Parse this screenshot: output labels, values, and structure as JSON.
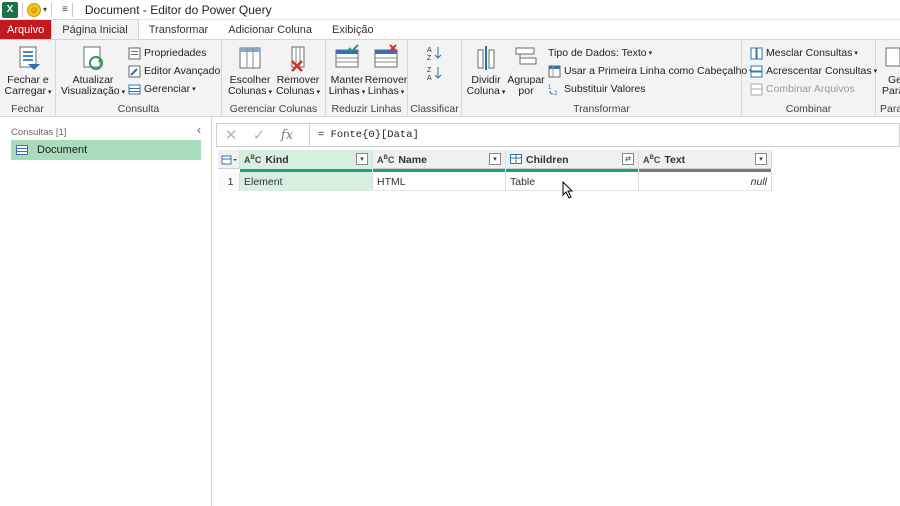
{
  "titlebar": {
    "app_icon": "X",
    "title": "Document - Editor do Power Query"
  },
  "tabs": [
    {
      "label": "Arquivo"
    },
    {
      "label": "Página Inicial"
    },
    {
      "label": "Transformar"
    },
    {
      "label": "Adicionar Coluna"
    },
    {
      "label": "Exibição"
    }
  ],
  "ribbon": {
    "fechar": {
      "btn1": "Fechar e",
      "btn2": "Carregar",
      "group": "Fechar"
    },
    "consulta": {
      "atualizar1": "Atualizar",
      "atualizar2": "Visualização",
      "propriedades": "Propriedades",
      "editor": "Editor Avançado",
      "gerenciar": "Gerenciar",
      "group": "Consulta"
    },
    "colunas": {
      "escolher1": "Escolher",
      "escolher2": "Colunas",
      "remover1": "Remover",
      "remover2": "Colunas",
      "group": "Gerenciar Colunas"
    },
    "linhas": {
      "manter1": "Manter",
      "manter2": "Linhas",
      "remover1": "Remover",
      "remover2": "Linhas",
      "group": "Reduzir Linhas"
    },
    "classificar": {
      "group": "Classificar"
    },
    "transformar": {
      "dividir1": "Dividir",
      "dividir2": "Coluna",
      "agrupar1": "Agrupar",
      "agrupar2": "por",
      "tipo": "Tipo de Dados: Texto",
      "primeira": "Usar a Primeira Linha como Cabeçalho",
      "substituir": "Substituir Valores",
      "group": "Transformar"
    },
    "combinar": {
      "mesclar": "Mesclar Consultas",
      "acrescentar": "Acrescentar Consultas",
      "arquivos": "Combinar Arquivos",
      "group": "Combinar"
    },
    "parametros": {
      "btn1": "Ge",
      "btn2": "Parâ",
      "group": "Para"
    }
  },
  "queries": {
    "header": "Consultas [1]",
    "items": [
      {
        "label": "Document"
      }
    ]
  },
  "formula": {
    "text": "= Fonte{0}[Data]"
  },
  "grid": {
    "columns": [
      {
        "name": "Kind",
        "type": "ABC"
      },
      {
        "name": "Name",
        "type": "ABC"
      },
      {
        "name": "Children",
        "type": "table"
      },
      {
        "name": "Text",
        "type": "ABC"
      }
    ],
    "rows": [
      {
        "num": "1",
        "cells": [
          "Element",
          "HTML",
          "Table",
          "null"
        ]
      }
    ]
  },
  "colors": {
    "file_tab": "#c2191f",
    "selection": "#a9dbbd",
    "quality": "#19a577"
  }
}
